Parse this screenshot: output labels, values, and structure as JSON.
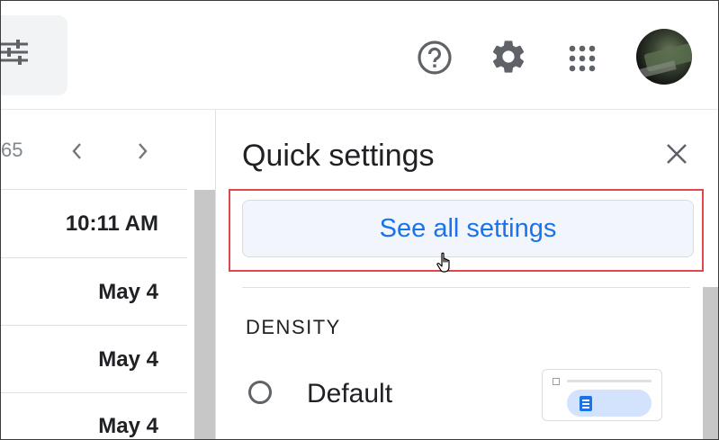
{
  "header": {
    "filter_icon": "tune-icon",
    "help_icon": "help-icon",
    "settings_icon": "gear-icon",
    "apps_icon": "apps-grid-icon",
    "avatar_icon": "avatar"
  },
  "pager": {
    "count_text": "65",
    "prev_icon": "chevron-left-icon",
    "next_icon": "chevron-right-icon"
  },
  "email_rows": [
    {
      "date": "10:11 AM"
    },
    {
      "date": "May 4"
    },
    {
      "date": "May 4"
    },
    {
      "date": "May 4"
    }
  ],
  "quick_settings": {
    "title": "Quick settings",
    "close_icon": "close-icon",
    "see_all_label": "See all settings",
    "density": {
      "title": "DENSITY",
      "options": [
        {
          "label": "Default",
          "selected": false
        }
      ]
    }
  },
  "colors": {
    "accent": "#1a73e8",
    "highlight_border": "#e0464c",
    "button_bg": "#f2f6fc"
  }
}
